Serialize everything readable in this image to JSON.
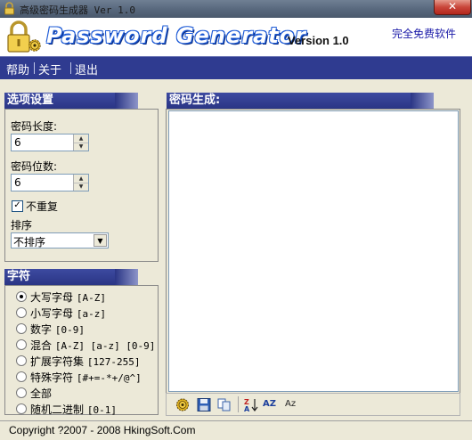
{
  "window": {
    "title": "高级密码生成器 Ver 1.0",
    "close_label": "✕"
  },
  "banner": {
    "logo": "Password Generator",
    "version": "Version 1.0",
    "tagline": "完全免费软件"
  },
  "menu": [
    "帮助",
    "关于",
    "退出"
  ],
  "options": {
    "header": "选项设置",
    "length_label": "密码长度:",
    "length_value": "6",
    "digits_label": "密码位数:",
    "digits_value": "6",
    "no_repeat_label": "不重复",
    "no_repeat_checked": true,
    "sort_label": "排序",
    "sort_value": "不排序"
  },
  "charset": {
    "header": "字符",
    "selected_index": 0,
    "items": [
      {
        "label": "大写字母",
        "code": "[A-Z]"
      },
      {
        "label": "小写字母",
        "code": "[a-z]"
      },
      {
        "label": "数字",
        "code": "[0-9]"
      },
      {
        "label": "混合",
        "code": "[A-Z] [a-z] [0-9]"
      },
      {
        "label": "扩展字符集",
        "code": "[127-255]"
      },
      {
        "label": "特殊字符",
        "code": "[#+=-*+/@^]"
      },
      {
        "label": "全部",
        "code": ""
      },
      {
        "label": "随机二进制",
        "code": "[0-1]"
      }
    ]
  },
  "output": {
    "header": "密码生成:"
  },
  "toolbar": {
    "sort_az_label": "AZ",
    "sort_za_label": "Az"
  },
  "status": {
    "copyright": "Copyright ?2007 - 2008 HkingSoft.Com"
  },
  "colors": {
    "menu_bg": "#2f3b90",
    "header_bg": "#2a3585",
    "logo_blue": "#1e5bd6"
  },
  "icons": {
    "app": "lock-icon",
    "gear": "gear-icon",
    "save": "floppy-disk-icon",
    "copy": "copy-icon",
    "sort_down": "sort-za-icon"
  }
}
